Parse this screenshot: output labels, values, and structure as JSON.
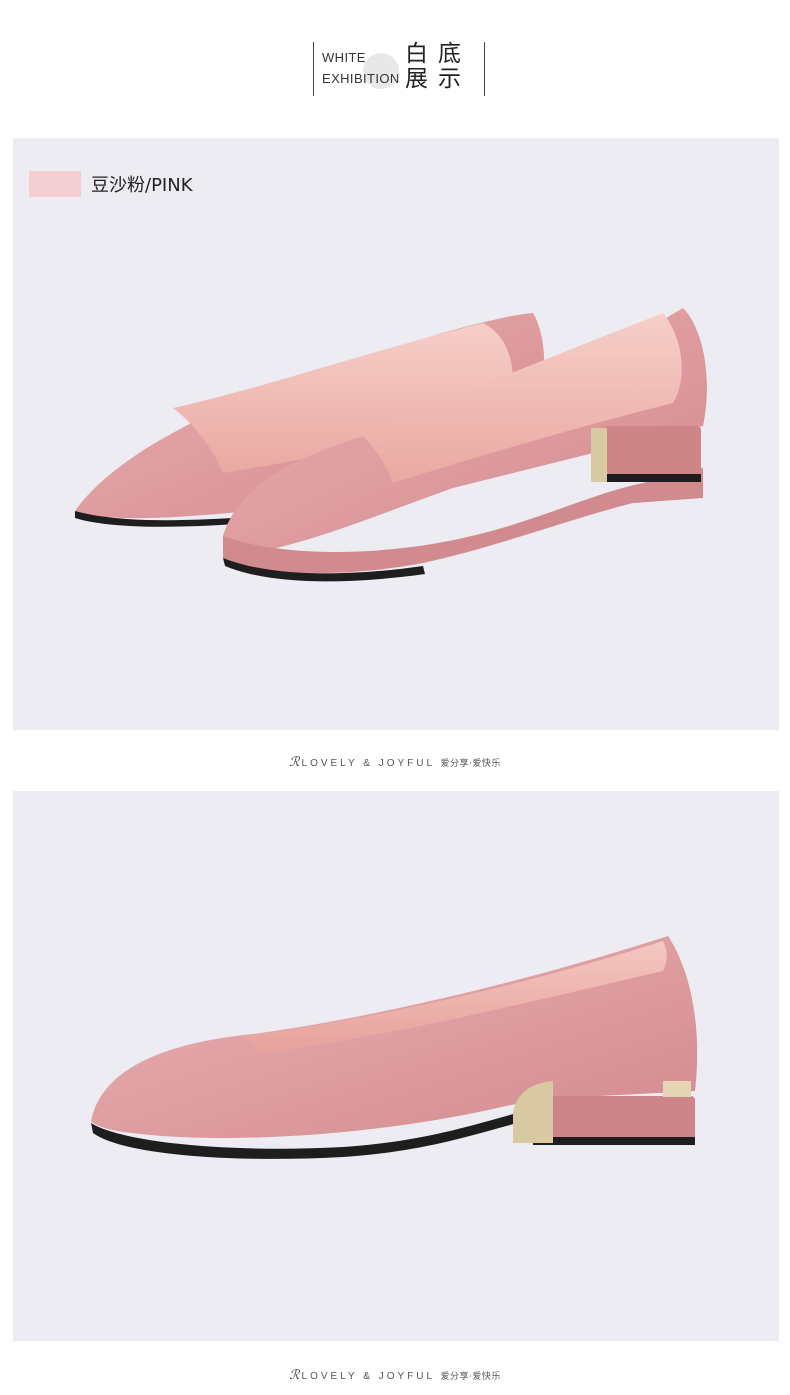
{
  "header": {
    "title_en_line1": "WHITE",
    "title_en_line2": "EXHIBITION",
    "title_cn_line1": "白底",
    "title_cn_line2": "展示"
  },
  "panel1": {
    "color_swatch_hex": "#f3ced2",
    "color_label": "豆沙粉/PINK",
    "image_alt": "pink-suede-pointed-toe-flats-pair"
  },
  "panel2": {
    "image_alt": "pink-suede-pointed-toe-flat-side-view"
  },
  "brand": {
    "logo_glyph": "ℛ",
    "slogan_en": "LOVELY & JOYFUL",
    "slogan_cn": "爱分享·爱快乐"
  },
  "colors": {
    "panel_bg": "#ececf2",
    "suede": "#e3a3a6",
    "suede_dark": "#c98387",
    "lining": "#f0b9b4",
    "sole": "#1e1e1e",
    "gold_heel": "#d9c9a3"
  }
}
